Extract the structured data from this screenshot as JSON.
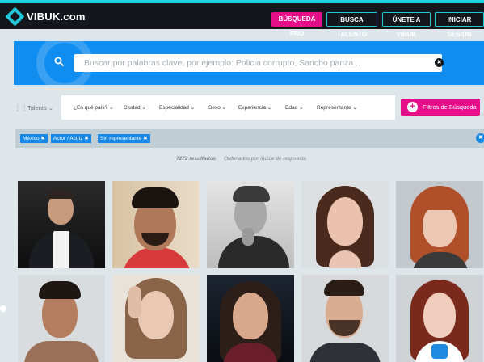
{
  "header": {
    "brand": "VIBUK.com",
    "nav": [
      {
        "label": "BÚSQUEDA PRO"
      },
      {
        "label": "BUSCA TALENTO"
      },
      {
        "label": "ÚNETE A VIBUK"
      },
      {
        "label": "INICIAR SESIÓN"
      }
    ]
  },
  "search": {
    "placeholder": "Buscar por palabras clave, por ejemplo: Policia corrupto, Sancho panza..."
  },
  "filters": {
    "category": "Talents",
    "items": [
      {
        "label": "¿En qué país?"
      },
      {
        "label": "Ciudad"
      },
      {
        "label": "Especialidad"
      },
      {
        "label": "Sexo"
      },
      {
        "label": "Experiencia"
      },
      {
        "label": "Edad"
      },
      {
        "label": "Representante"
      }
    ],
    "button": "Filtros de Búsqueda"
  },
  "active_filters": [
    {
      "label": "México"
    },
    {
      "label": "Actor / Actriz"
    },
    {
      "label": "Sin representante"
    }
  ],
  "results": {
    "count": "7272 resultados",
    "order": "Ordenados por índice de respuesta"
  },
  "colors": {
    "accent_pink": "#e60f8a",
    "accent_cyan": "#21c9db",
    "search_blue": "#0f8df0",
    "chip_blue": "#1689e6"
  }
}
